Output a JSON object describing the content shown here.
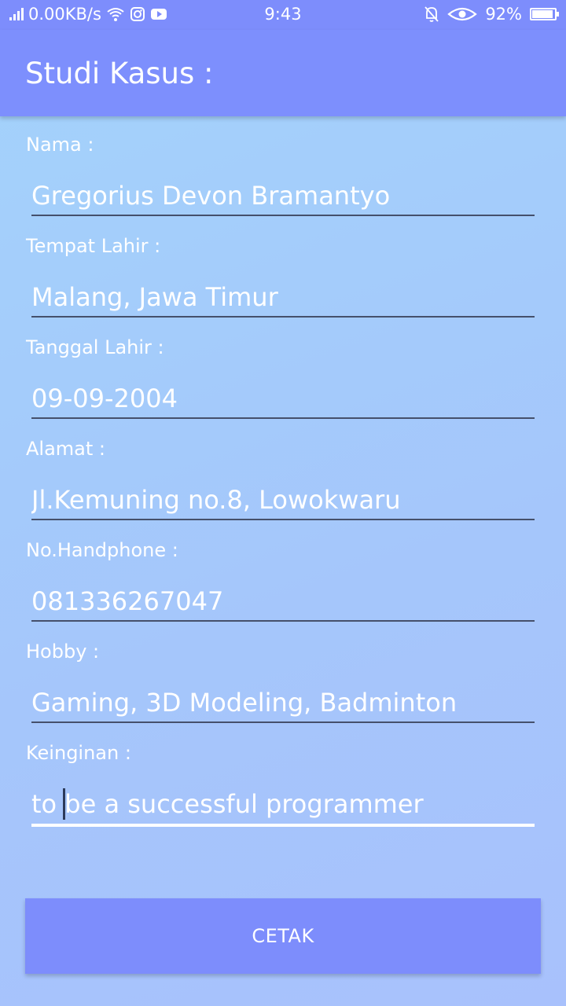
{
  "status_bar": {
    "network_speed": "0.00KB/s",
    "time": "9:43",
    "battery_percent": "92%",
    "battery_level": 0.92,
    "icons": [
      "signal-icon",
      "wifi-icon",
      "instagram-icon",
      "youtube-icon",
      "bell-muted-icon",
      "eye-icon",
      "battery-icon"
    ]
  },
  "app_bar": {
    "title": "Studi Kasus :",
    "color": "#7d8ffd"
  },
  "form": {
    "fields": [
      {
        "label": "Nama :",
        "value": "Gregorius Devon Bramantyo"
      },
      {
        "label": "Tempat Lahir :",
        "value": "Malang, Jawa Timur"
      },
      {
        "label": "Tanggal Lahir :",
        "value": "09-09-2004"
      },
      {
        "label": "Alamat :",
        "value": "Jl.Kemuning no.8, Lowokwaru"
      },
      {
        "label": "No.Handphone :",
        "value": "081336267047"
      },
      {
        "label": "Hobby :",
        "value": "Gaming, 3D Modeling, Badminton"
      },
      {
        "label": "Keinginan :",
        "value": "to be a successful programmer"
      }
    ]
  },
  "button": {
    "label": "CETAK",
    "color": "#7d8dfc"
  }
}
